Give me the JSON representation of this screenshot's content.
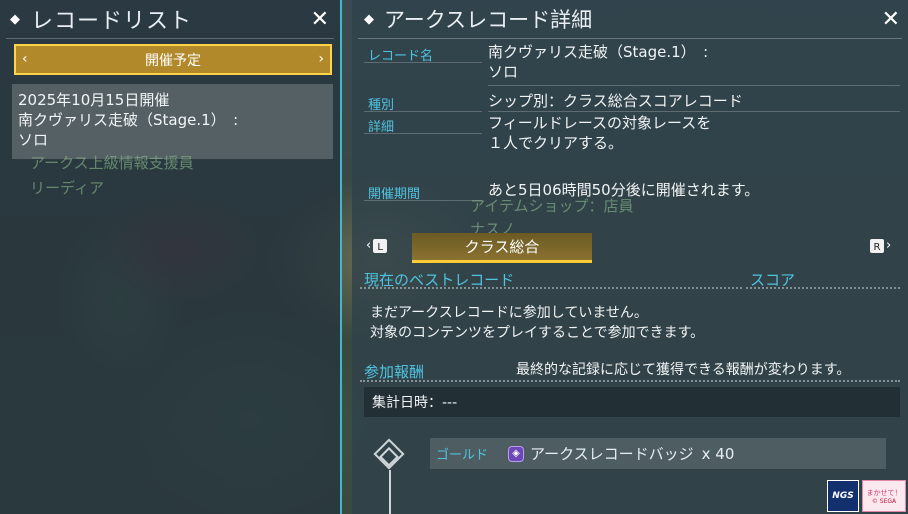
{
  "left_panel": {
    "title": "レコードリスト",
    "close_glyph": "✕",
    "tab": {
      "label": "開催予定",
      "left_arrow": "‹",
      "right_arrow": "›"
    },
    "records": [
      {
        "date": "2025年10月15日開催",
        "name": "南クヴァリス走破（Stage.1）　:",
        "mode": "ソロ"
      }
    ],
    "background_labels": [
      "アークス上級情報支援員",
      "リーディア"
    ]
  },
  "right_panel": {
    "title": "アークスレコード詳細",
    "close_glyph": "✕",
    "fields": {
      "record_name_label": "レコード名",
      "record_name_value_1": "南クヴァリス走破（Stage.1）　:",
      "record_name_value_2": "ソロ",
      "type_label": "種別",
      "type_value": "シップ別：クラス総合スコアレコード",
      "detail_label": "詳細",
      "detail_value_1": "フィールドレースの対象レースを",
      "detail_value_2": "１人でクリアする。",
      "period_label": "開催期間",
      "period_value": "あと5日06時間50分後に開催されます。"
    },
    "background_labels": [
      "アイテムショップ：店員",
      "ナスノ"
    ],
    "category_tab": {
      "label": "クラス総合",
      "prev_key": "L",
      "next_key": "R"
    },
    "best_record": {
      "title": "現在のベストレコード",
      "score_title": "スコア",
      "message_1": "まだアークスレコードに参加していません。",
      "message_2": "対象のコンテンツをプレイすることで参加できます。"
    },
    "reward": {
      "title": "参加報酬",
      "note": "最終的な記録に応じて獲得できる報酬が変わります。",
      "tally_label": "集計日時：---",
      "tiers": [
        {
          "tier": "ゴールド",
          "item": "アークスレコードバッジ",
          "qty": "x  40"
        }
      ]
    }
  },
  "logos": {
    "ngs": "NGS",
    "seg_line1": "まかせて！",
    "seg_line2": "© SEGA"
  },
  "colors": {
    "accent_cyan": "#4fc3e0",
    "gold": "#ffcc33",
    "panel_border": "#3fb9c9"
  }
}
